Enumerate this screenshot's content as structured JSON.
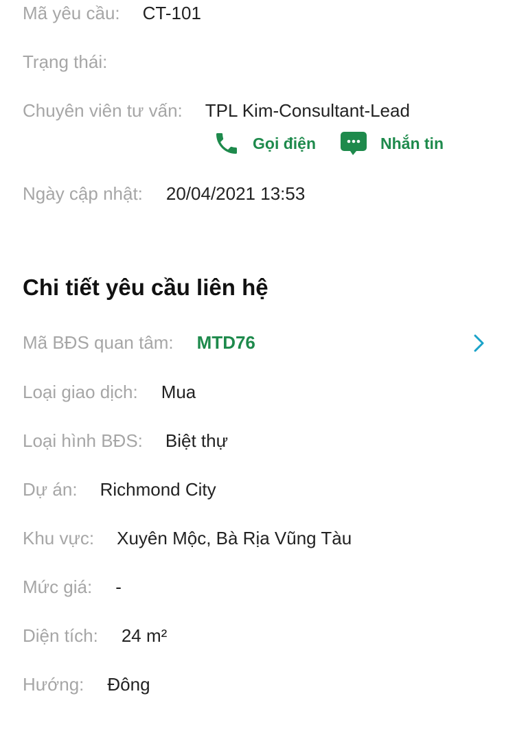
{
  "request_info": {
    "request_code": {
      "label": "Mã yêu cầu:",
      "value": "CT-101"
    },
    "status": {
      "label": "Trạng thái:",
      "value": ""
    },
    "consultant": {
      "label": "Chuyên viên tư vấn:",
      "value": "TPL Kim-Consultant-Lead",
      "call_label": "Gọi điện",
      "message_label": "Nhắn tin"
    },
    "updated_date": {
      "label": "Ngày cập nhật:",
      "value": "20/04/2021 13:53"
    }
  },
  "contact_details": {
    "title": "Chi tiết yêu cầu liên hệ",
    "property_code": {
      "label": "Mã BĐS quan tâm:",
      "value": "MTD76"
    },
    "transaction_type": {
      "label": "Loại giao dịch:",
      "value": "Mua"
    },
    "property_type": {
      "label": "Loại hình BĐS:",
      "value": "Biệt thự"
    },
    "project": {
      "label": "Dự án:",
      "value": "Richmond City"
    },
    "area_region": {
      "label": "Khu vực:",
      "value": "Xuyên Mộc, Bà Rịa Vũng Tàu"
    },
    "price": {
      "label": "Mức giá:",
      "value": "-"
    },
    "acreage": {
      "label": "Diện tích:",
      "value": "24 m²"
    },
    "direction": {
      "label": "Hướng:",
      "value": "Đông"
    }
  },
  "icons": {
    "phone": "phone-icon",
    "message": "chat-bubble-icon",
    "chevron": "chevron-right-icon"
  },
  "colors": {
    "accent_green": "#1e8a4c",
    "chevron_blue": "#1aa3c9",
    "label_gray": "#a6a6a6",
    "value_dark": "#222222"
  }
}
